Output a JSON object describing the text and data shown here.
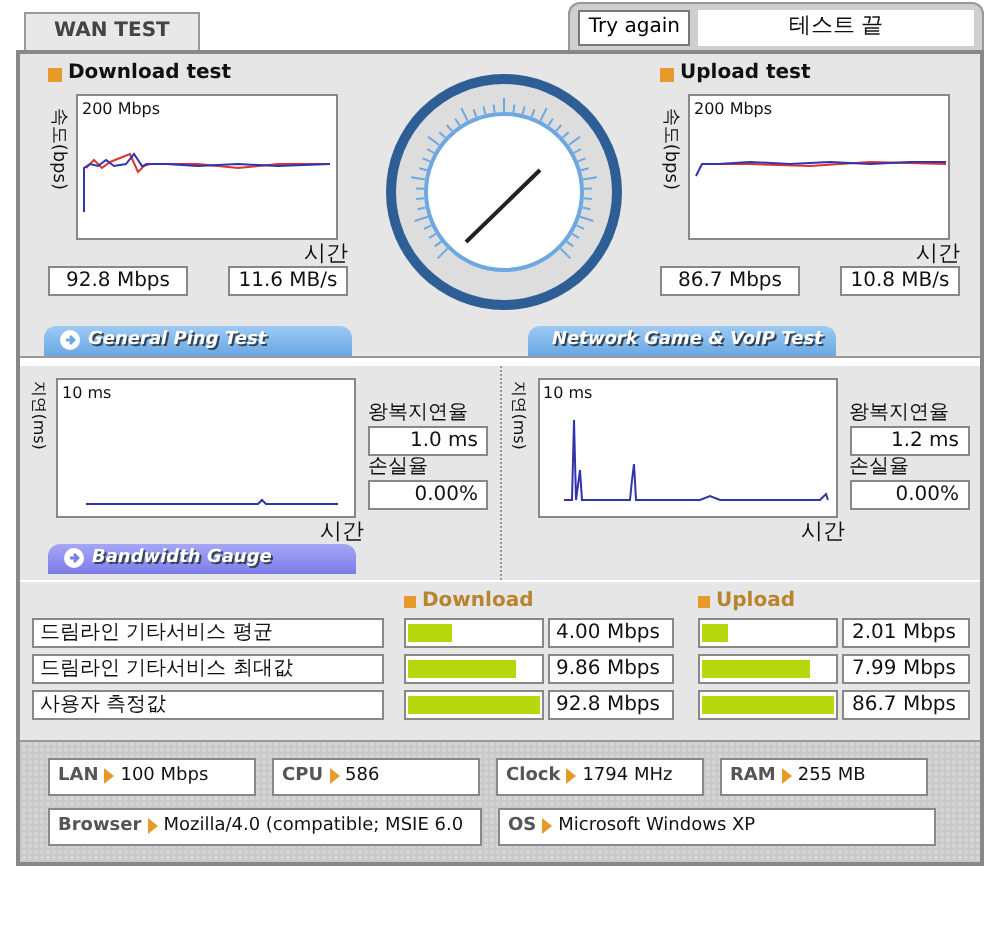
{
  "tabs": [
    {
      "label": "WAN TEST",
      "selected": true
    }
  ],
  "try_again_button": "Try again",
  "status_field": "테스트 끝",
  "speed_tests": [
    {
      "title": "Download test",
      "y_axis": "속도(bps)",
      "scale": "200 Mbps",
      "x_axis": "시간",
      "mbps": "92.8 Mbps",
      "mbs": "11.6 MB/s"
    },
    {
      "title": "Upload test",
      "y_axis": "속도(bps)",
      "scale": "200 Mbps",
      "x_axis": "시간",
      "mbps": "86.7 Mbps",
      "mbs": "10.8 MB/s"
    }
  ],
  "ping_tests": [
    {
      "title": "General Ping Test",
      "y_axis": "지연(ms)",
      "scale": "10 ms",
      "x_axis": "시간",
      "latency_label": "왕복지연율",
      "latency": "1.0 ms",
      "loss_label": "손실율",
      "loss": "0.00%"
    },
    {
      "title": "Network Game & VoIP Test",
      "y_axis": "지연(ms)",
      "scale": "10 ms",
      "x_axis": "시간",
      "latency_label": "왕복지연율",
      "latency": "1.2 ms",
      "loss_label": "손실율",
      "loss": "0.00%"
    }
  ],
  "bandwidth": {
    "title": "Bandwidth Gauge",
    "download_header": "Download",
    "upload_header": "Upload",
    "rows": [
      {
        "label": "드림라인 기타서비스 평균",
        "download": {
          "level": 0.33,
          "reading": "4.00 Mbps"
        },
        "upload": {
          "level": 0.2,
          "reading": "2.01 Mbps"
        }
      },
      {
        "label": "드림라인 기타서비스 최대값",
        "download": {
          "level": 0.82,
          "reading": "9.86 Mbps"
        },
        "upload": {
          "level": 0.82,
          "reading": "7.99 Mbps"
        }
      },
      {
        "label": "사용자 측정값",
        "download": {
          "level": 1,
          "reading": "92.8 Mbps"
        },
        "upload": {
          "level": 1,
          "reading": "86.7 Mbps"
        }
      }
    ]
  },
  "system_info": [
    {
      "label": "LAN",
      "value": "100 Mbps"
    },
    {
      "label": "CPU",
      "value": "586"
    },
    {
      "label": "Clock",
      "value": "1794 MHz"
    },
    {
      "label": "RAM",
      "value": "255 MB"
    },
    {
      "label": "Browser",
      "value": "Mozilla/4.0 (compatible; MSIE 6.0"
    },
    {
      "label": "OS",
      "value": "Microsoft Windows XP"
    }
  ]
}
